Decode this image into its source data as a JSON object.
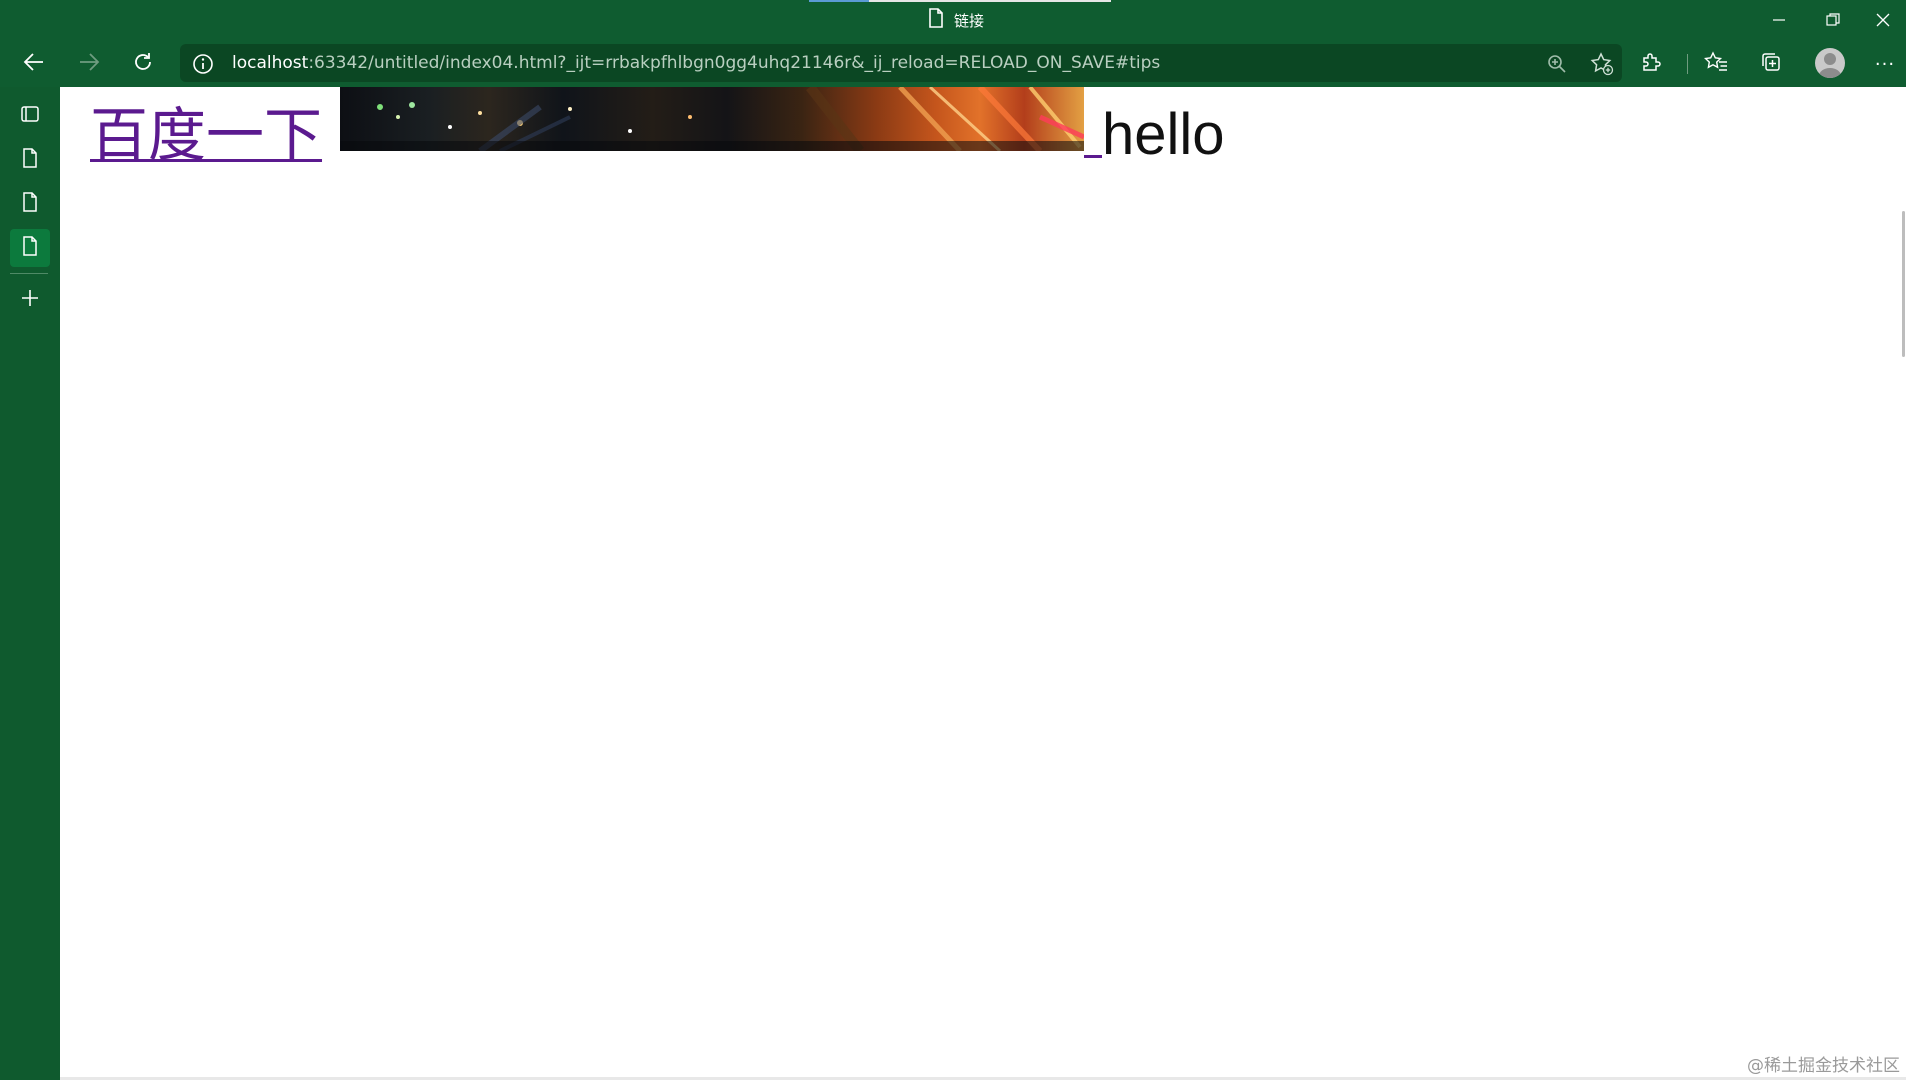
{
  "window": {
    "tab_title": "链接",
    "minimize_glyph": "—",
    "restore_glyph": "❐",
    "close_glyph": "✕"
  },
  "toolbar": {
    "back_icon": "arrow-left-icon",
    "forward_icon": "arrow-right-icon",
    "refresh_icon": "refresh-icon",
    "address_host": "localhost",
    "address_rest": ":63342/untitled/index04.html?_ijt=rrbakpfhlbgn0gg4uhq21146r&_ij_reload=RELOAD_ON_SAVE#tips",
    "more_glyph": "···"
  },
  "sidebar": {
    "items": [
      {
        "icon": "tab-actions-icon"
      },
      {
        "icon": "page-icon"
      },
      {
        "icon": "page-icon"
      },
      {
        "icon": "page-icon",
        "active": true
      },
      {
        "icon": "plus-icon"
      }
    ]
  },
  "page": {
    "link_text": "百度一下",
    "hello_text": "hello"
  },
  "watermark": "@稀土掘金技术社区",
  "colors": {
    "chrome_green": "#0f5c30",
    "address_bg": "#0b4723",
    "visited_link": "#5b1a8f"
  }
}
